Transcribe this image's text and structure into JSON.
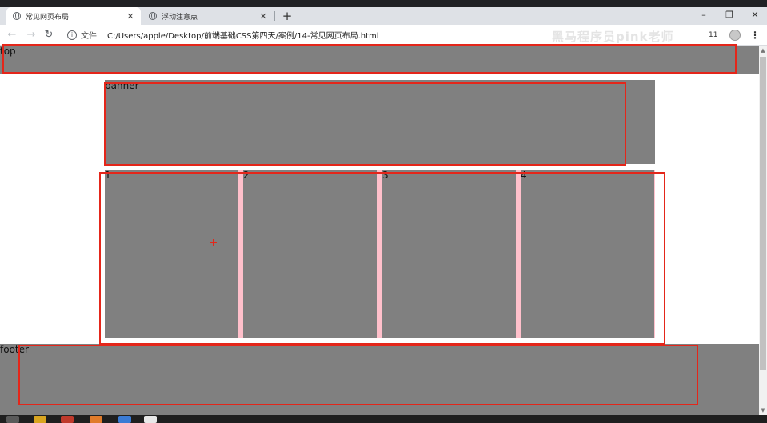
{
  "browser": {
    "tabs": [
      {
        "title": "常见网页布局",
        "close": "✕"
      },
      {
        "title": "浮动注意点",
        "close": "✕"
      }
    ],
    "new_tab": "+",
    "window_controls": {
      "minimize": "–",
      "restore": "❐",
      "close": "✕"
    },
    "nav": {
      "back": "←",
      "forward": "→",
      "reload": "↻"
    },
    "address": {
      "info": "i",
      "scheme_label": "文件",
      "url": "C:/Users/apple/Desktop/前端基础CSS第四天/案例/14-常见网页布局.html"
    },
    "watermark": "黑马程序员pink老师",
    "zoom_badge": "11",
    "menu": "⋮"
  },
  "page": {
    "top_label": "top",
    "banner_label": "banner",
    "boxes": [
      "1",
      "2",
      "3",
      "4"
    ],
    "footer_label": "footer"
  },
  "scrollbar": {
    "up": "▲",
    "down": "▼"
  },
  "colors": {
    "block_gray": "#808080",
    "box_gap_pink": "#ffc0cb",
    "annotation_red": "#e4261a",
    "chrome_dark": "#202124",
    "tabstrip": "#dee1e6"
  }
}
